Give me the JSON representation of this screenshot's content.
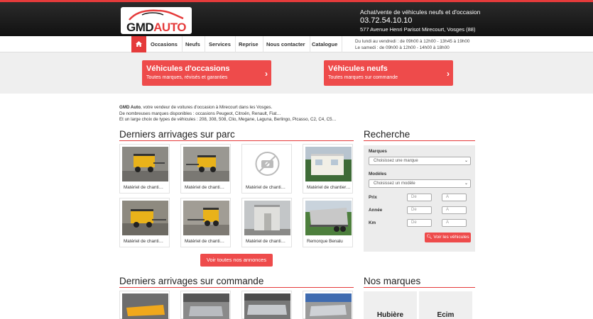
{
  "header": {
    "logo_prefix": "GMD",
    "logo_suffix": "AUTO",
    "tagline": "Achat/vente de véhicules neufs et d'occasion",
    "phone": "03.72.54.10.10",
    "address": "577 Avenue Henri Parisot Mirecourt, Vosges (88)"
  },
  "nav": {
    "items": [
      "Occasions",
      "Neufs",
      "Services",
      "Reprise",
      "Nous contacter",
      "Catalogue"
    ],
    "hours_line1": "Du lundi au vendredi : de 09h00 à 12h00 - 13h45 à 19h00",
    "hours_line2": "Le samedi : de 09h00 à 12h00 - 14h00 à 18h00"
  },
  "banner": {
    "occasions_title": "Véhicules d'occasions",
    "occasions_sub": "Toutes marques, révisés et garanties",
    "neufs_title": "Véhicules neufs",
    "neufs_sub": "Toutes marques sur commande"
  },
  "intro": {
    "brand": "GMD Auto",
    "line1_rest": ", votre vendeur de voitures d'occasion à Mirecourt dans les Vosges.",
    "line2": "De nombreuses marques disponibles : occasions Peugeot, Citroën, Renault, Fiat…",
    "line3": "Et un large choix de types de véhicules : 208, 308, 508, Clio, Megane, Laguna, Berlingo, Picasso, C2, C4, C5…"
  },
  "parc": {
    "title": "Derniers arrivages sur parc",
    "cards": [
      {
        "caption": "Matériel de chanti…",
        "photo": "yellow-generator"
      },
      {
        "caption": "Matériel de chanti…",
        "photo": "yellow-generator"
      },
      {
        "caption": "Matériel de chanti…",
        "photo": "no-photo-icon"
      },
      {
        "caption": "Matériel de chantier…",
        "photo": "site-cabin"
      },
      {
        "caption": "Matériel de chanti…",
        "photo": "yellow-generator"
      },
      {
        "caption": "Matériel de chanti…",
        "photo": "yellow-generator"
      },
      {
        "caption": "Matériel de chanti…",
        "photo": "grey-cabin"
      },
      {
        "caption": "Remorque Benalu",
        "photo": "benne-trailer"
      }
    ],
    "see_all": "Voir toutes nos annonces"
  },
  "commande": {
    "title": "Derniers arrivages sur commande"
  },
  "search": {
    "title": "Recherche",
    "marques_label": "Marques",
    "marques_placeholder": "Choisissez une marque",
    "modeles_label": "Modèles",
    "modeles_placeholder": "Choisissez un modèle",
    "prix_label": "Prix",
    "annee_label": "Année",
    "km_label": "Km",
    "from_placeholder": "De",
    "to_placeholder": "A",
    "submit": "Voir les véhicules"
  },
  "brands": {
    "title": "Nos marques",
    "items": [
      "Hubière",
      "Ecim"
    ]
  },
  "colors": {
    "accent": "#e53b3b",
    "button": "#ee4b4b",
    "header_bg": "#111111"
  }
}
